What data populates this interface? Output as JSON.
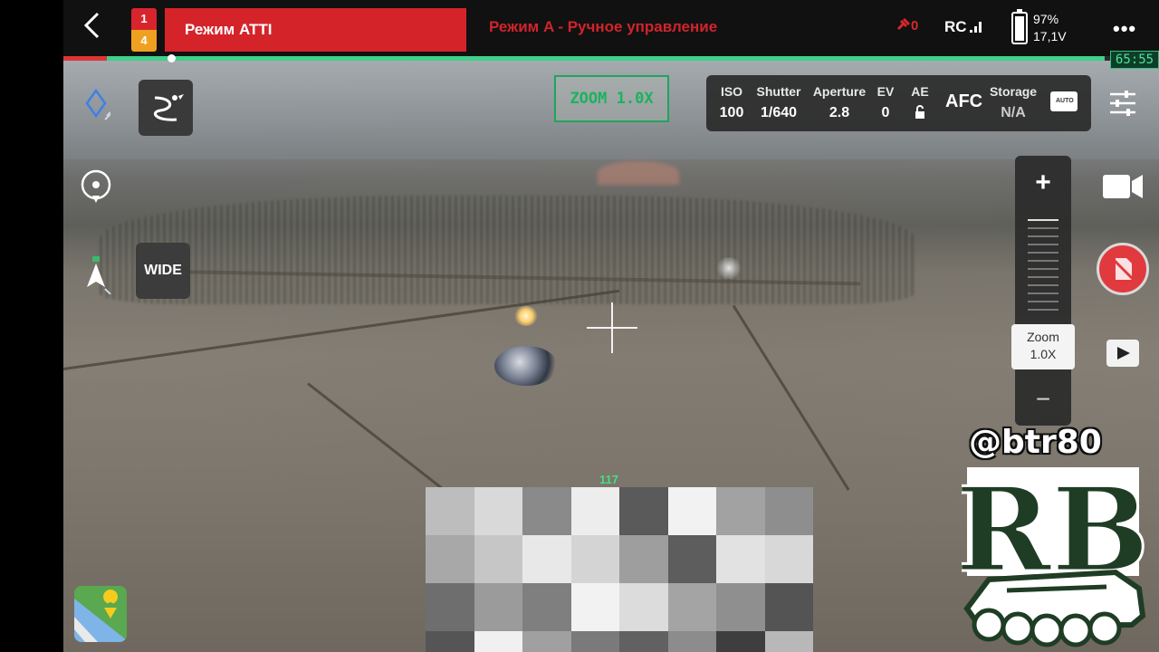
{
  "topbar": {
    "flight_badge_top": "1",
    "flight_badge_bottom": "4",
    "atti_label": "Режим ATTI",
    "mode_text": "Режим A - Ручное управление",
    "signal_count": "0",
    "rc_label": "RC",
    "battery_percent": "97%",
    "battery_voltage": "17,1V",
    "more_label": "•••"
  },
  "progress": {
    "fraction": 0.95
  },
  "time_badge": "65:55",
  "left_controls": {
    "wide_label": "WIDE"
  },
  "zoom_badge": "ZOOM 1.0X",
  "camera_params": {
    "iso_label": "ISO",
    "iso_value": "100",
    "shutter_label": "Shutter",
    "shutter_value": "1/640",
    "aperture_label": "Aperture",
    "aperture_value": "2.8",
    "ev_label": "EV",
    "ev_value": "0",
    "ae_label": "AE",
    "focus_mode": "AFC",
    "storage_label": "Storage",
    "storage_value": "N/A",
    "storage_icon_text": "AUTO"
  },
  "zoom_slider": {
    "plus": "+",
    "minus": "−",
    "readout_label": "Zoom",
    "readout_value": "1.0X"
  },
  "altitude_label": "117",
  "watermark": {
    "handle": "@btr80",
    "logo_text": "RB"
  },
  "icons": {
    "back": "chevron-left-icon",
    "diamond": "diamond-icon",
    "route": "route-icon",
    "target": "target-icon",
    "compass": "compass-icon",
    "map": "map-icon",
    "settings": "sliders-icon",
    "video": "video-camera-icon",
    "record": "no-sd-card-icon",
    "play": "play-icon"
  },
  "colors": {
    "alert_red": "#d5232a",
    "accent_green": "#3fd08a",
    "panel_dark": "#2a2a2a"
  },
  "censor_pattern": [
    [
      "#bdbdbd",
      "#d9d9d9",
      "#8a8a8a",
      "#ededed",
      "#5a5a5a",
      "#f2f2f2",
      "#a2a2a2",
      "#8e8e8e"
    ],
    [
      "#a8a8a8",
      "#c6c6c6",
      "#e8e8e8",
      "#d4d4d4",
      "#9e9e9e",
      "#5d5d5d",
      "#e2e2e2",
      "#d8d8d8"
    ],
    [
      "#6e6e6e",
      "#9b9b9b",
      "#7f7f7f",
      "#f2f2f2",
      "#dcdcdc",
      "#a4a4a4",
      "#8f8f8f",
      "#545454"
    ],
    [
      "#555555",
      "#f0f0f0",
      "#a0a0a0",
      "#7a7a7a",
      "#616161",
      "#8c8c8c",
      "#3e3e3e",
      "#b8b8b8"
    ]
  ]
}
